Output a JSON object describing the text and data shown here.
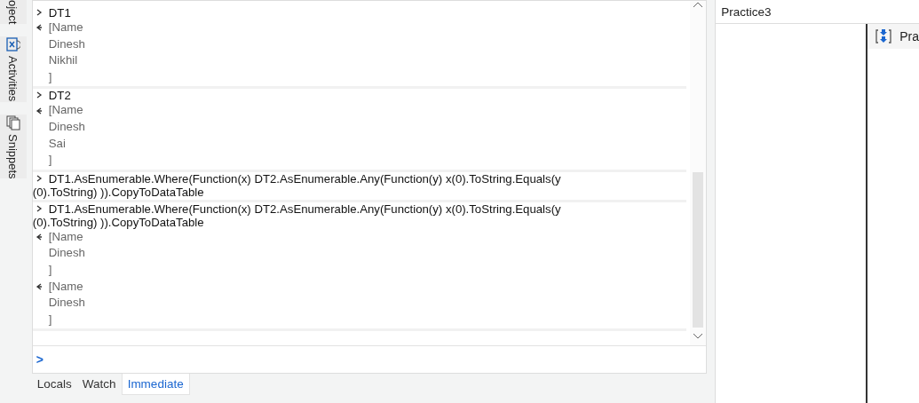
{
  "side_tabs": [
    {
      "label": "oject"
    },
    {
      "label": "Activities"
    },
    {
      "label": "Snippets"
    }
  ],
  "immediate": {
    "groups": [
      {
        "entries": [
          {
            "kind": "input",
            "text": "DT1"
          },
          {
            "kind": "output",
            "lines": [
              "[Name",
              "Dinesh",
              "Nikhil",
              "]"
            ]
          }
        ]
      },
      {
        "entries": [
          {
            "kind": "input",
            "text": "DT2"
          },
          {
            "kind": "output",
            "lines": [
              "[Name",
              "Dinesh",
              "Sai",
              "]"
            ]
          }
        ]
      },
      {
        "entries": [
          {
            "kind": "input",
            "text": "DT1.AsEnumerable.Where(Function(x) DT2.AsEnumerable.Any(Function(y) x(0).ToString.Equals(y (0).ToString) )).CopyToDataTable"
          }
        ]
      },
      {
        "entries": [
          {
            "kind": "input",
            "text": "DT1.AsEnumerable.Where(Function(x) DT2.AsEnumerable.Any(Function(y) x(0).ToString.Equals(y (0).ToString) )).CopyToDataTable"
          },
          {
            "kind": "output",
            "lines": [
              "[Name",
              "Dinesh",
              "]"
            ]
          },
          {
            "kind": "output",
            "lines": [
              "[Name",
              "Dinesh",
              "]"
            ]
          }
        ]
      }
    ],
    "prompt": ">"
  },
  "bottom_tabs": [
    {
      "label": "Locals",
      "selected": false
    },
    {
      "label": "Watch",
      "selected": false
    },
    {
      "label": "Immediate",
      "selected": true
    }
  ],
  "designer": {
    "title": "Practice3",
    "item": "Pra"
  }
}
